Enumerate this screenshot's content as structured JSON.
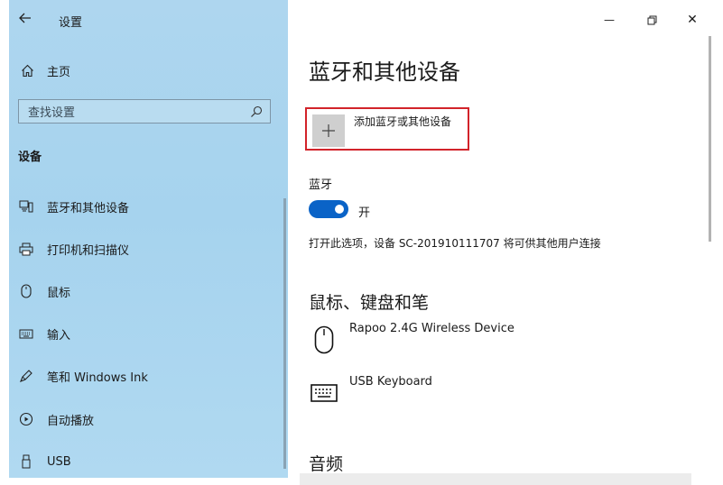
{
  "window": {
    "app_title": "设置",
    "minimize_glyph": "—",
    "close_glyph": "✕"
  },
  "sidebar": {
    "home_label": "主页",
    "search_placeholder": "查找设置",
    "section_title": "设备",
    "items": [
      {
        "label": "蓝牙和其他设备",
        "icon": "bluetooth-devices-icon"
      },
      {
        "label": "打印机和扫描仪",
        "icon": "printer-icon"
      },
      {
        "label": "鼠标",
        "icon": "mouse-icon"
      },
      {
        "label": "输入",
        "icon": "keyboard-icon"
      },
      {
        "label": "笔和 Windows Ink",
        "icon": "pen-icon"
      },
      {
        "label": "自动播放",
        "icon": "autoplay-icon"
      },
      {
        "label": "USB",
        "icon": "usb-icon"
      }
    ]
  },
  "main": {
    "title": "蓝牙和其他设备",
    "add_device": {
      "plus": "+",
      "label": "添加蓝牙或其他设备"
    },
    "bluetooth": {
      "heading": "蓝牙",
      "toggle_on": true,
      "state_label": "开",
      "description": "打开此选项，设备 SC-201910111707 将可供其他用户连接"
    },
    "mouse_section": {
      "heading": "鼠标、键盘和笔",
      "devices": [
        {
          "name": "Rapoo 2.4G Wireless Device",
          "icon": "mouse-icon"
        },
        {
          "name": "USB Keyboard",
          "icon": "keyboard-icon"
        }
      ]
    },
    "audio_heading": "音频"
  },
  "colors": {
    "accent": "#0a63c7",
    "highlight_border": "#d2232a",
    "sidebar_bg": "#a9d4ef"
  }
}
